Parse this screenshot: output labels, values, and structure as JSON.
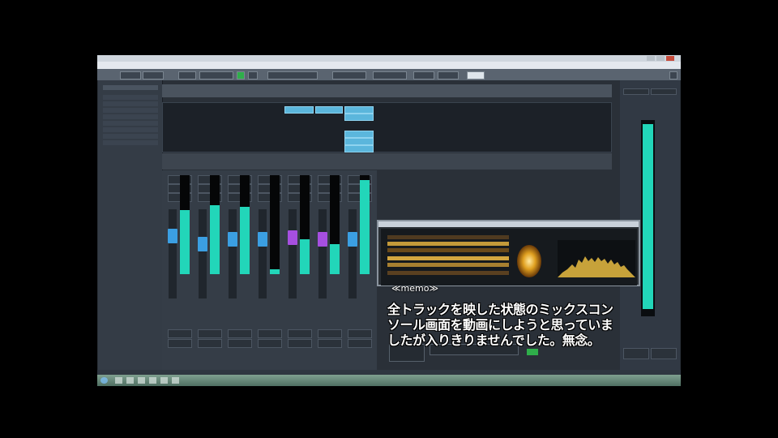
{
  "memo": {
    "tag": "≪memo≫",
    "line1": "全トラックを映した状態のミックスコン",
    "line2": "ソール画面を動画にしようと思っていま",
    "line3": "したが入りきりませんでした。無念。"
  },
  "colors": {
    "meter_fill": "#22d6b9",
    "fader_cap_blue": "#3b9fe2",
    "fader_cap_purple": "#a64fe0",
    "clip_blue": "#5bb6dc",
    "transport_green": "#2fae4a"
  },
  "icons": [
    "minimize-icon",
    "maximize-icon",
    "close-icon",
    "play-icon",
    "record-icon",
    "start-button-icon"
  ],
  "mixer": {
    "channels": [
      {
        "cap": "blue",
        "level": 0.65
      },
      {
        "cap": "blue",
        "level": 0.7
      },
      {
        "cap": "blue",
        "level": 0.68
      },
      {
        "cap": "blue",
        "level": 0.05
      },
      {
        "cap": "purple",
        "level": 0.35
      },
      {
        "cap": "purple",
        "level": 0.3
      },
      {
        "cap": "blue",
        "level": 0.95
      }
    ]
  },
  "master_meter_level": 0.97
}
